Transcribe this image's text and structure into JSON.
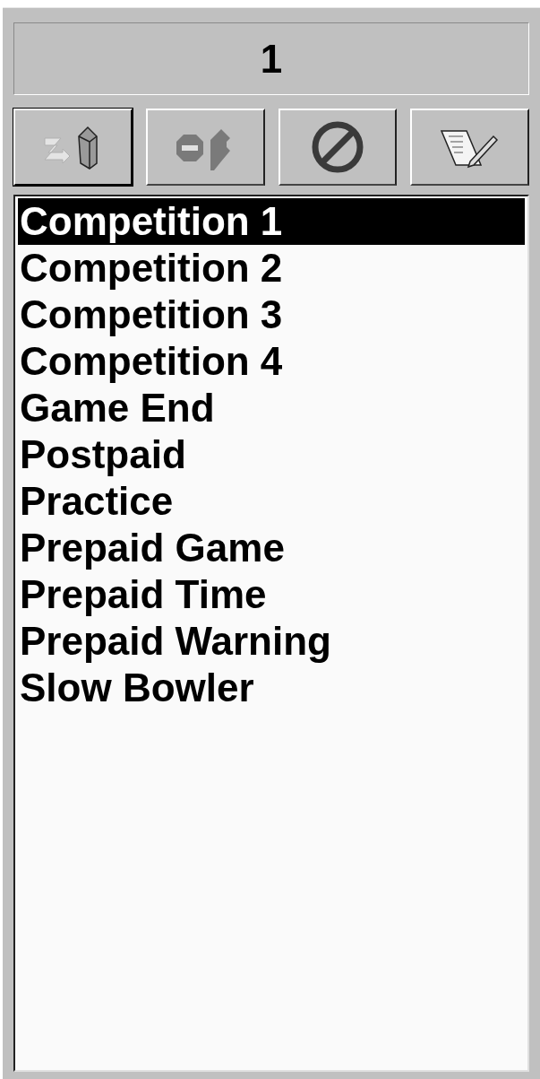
{
  "header": {
    "value": "1"
  },
  "toolbar": [
    {
      "kind": "import",
      "focused": true
    },
    {
      "kind": "stop-export",
      "focused": false
    },
    {
      "kind": "prohibit",
      "focused": false
    },
    {
      "kind": "edit",
      "focused": false
    }
  ],
  "list": [
    {
      "label": "Competition 1",
      "selected": true
    },
    {
      "label": "Competition 2",
      "selected": false
    },
    {
      "label": "Competition 3",
      "selected": false
    },
    {
      "label": "Competition 4",
      "selected": false
    },
    {
      "label": "Game End",
      "selected": false
    },
    {
      "label": "Postpaid",
      "selected": false
    },
    {
      "label": "Practice",
      "selected": false
    },
    {
      "label": "Prepaid Game",
      "selected": false
    },
    {
      "label": "Prepaid Time",
      "selected": false
    },
    {
      "label": "Prepaid Warning",
      "selected": false
    },
    {
      "label": "Slow Bowler",
      "selected": false
    }
  ]
}
